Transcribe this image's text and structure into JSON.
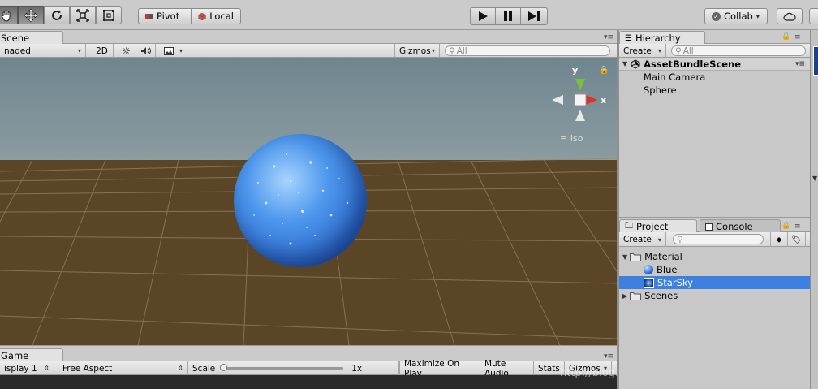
{
  "toolbar": {
    "pivot_label": "Pivot",
    "local_label": "Local",
    "collab_label": "Collab",
    "dropdown_glyph": "▾"
  },
  "scene": {
    "tab_label": "Scene",
    "shading_label": "naded",
    "mode_2d_label": "2D",
    "gizmos_label": "Gizmos",
    "search_placeholder": "All",
    "axis_y_label": "y",
    "axis_x_label": "x",
    "iso_label": "Iso",
    "sky_color": "#7a8f9a",
    "ground_color": "#5a4526",
    "sphere_color": "#3f86e0"
  },
  "hierarchy": {
    "tab_label": "Hierarchy",
    "create_label": "Create",
    "search_placeholder": "All",
    "scene_name": "AssetBundleScene",
    "items": [
      "Main Camera",
      "Sphere"
    ]
  },
  "project": {
    "tab_label": "Project",
    "console_tab_label": "Console",
    "create_label": "Create",
    "folders": [
      {
        "label": "Material",
        "children": [
          "Blue",
          "StarSky"
        ]
      },
      {
        "label": "Scenes"
      }
    ],
    "selected_item": "StarSky"
  },
  "game": {
    "tab_label": "Game",
    "display_label": "isplay 1",
    "aspect_label": "Free Aspect",
    "scale_label": "Scale",
    "scale_value": "1x",
    "maximize_label": "Maximize On Play",
    "mute_label": "Mute Audio",
    "stats_label": "Stats",
    "gizmos_label": "Gizmos"
  },
  "watermark": "http://blog.csdn.net/u014361280"
}
